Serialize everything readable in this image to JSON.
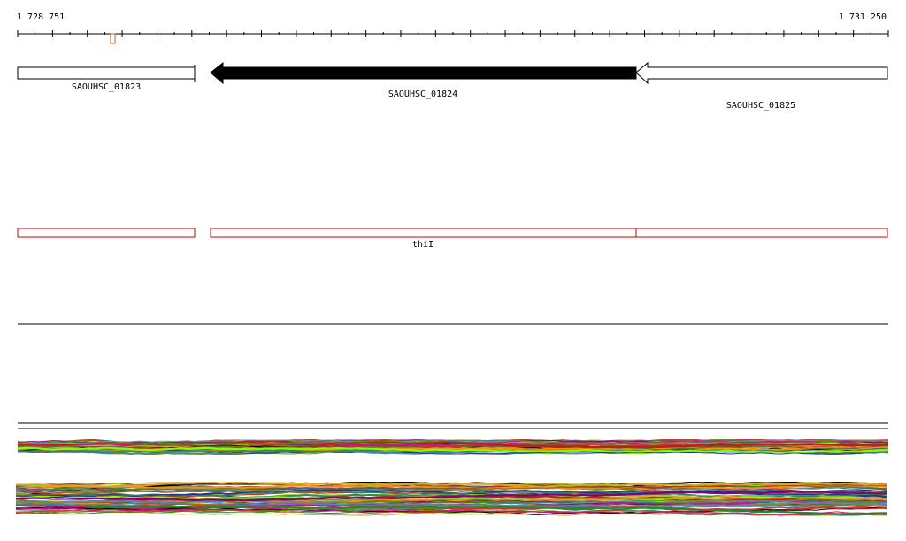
{
  "coordinates": {
    "start": "1 728 751",
    "end": "1 731 250"
  },
  "genes": [
    {
      "label": "SAOUHSC_01823",
      "filled": false,
      "strand": "+"
    },
    {
      "label": "SAOUHSC_01824",
      "filled": true,
      "strand": "-"
    },
    {
      "label": "SAOUHSC_01825",
      "filled": false,
      "strand": "-"
    }
  ],
  "features": [
    {
      "label": ""
    },
    {
      "label": "thiI"
    },
    {
      "label": ""
    }
  ],
  "colors": {
    "feature_outline": "#cc0000",
    "marker": "#e05020",
    "gene_fill": "#000000",
    "tracks": [
      "#000000",
      "#8b4513",
      "#228b22",
      "#6b8e23",
      "#cc3333",
      "#1e3a8a",
      "#9acd32",
      "#ff8c00",
      "#708090",
      "#a0522d",
      "#2e8b57",
      "#800080",
      "#4682b4",
      "#c71585",
      "#daa520",
      "#556b2f",
      "#b22222",
      "#5f9ea0",
      "#808000",
      "#7fff00"
    ]
  }
}
